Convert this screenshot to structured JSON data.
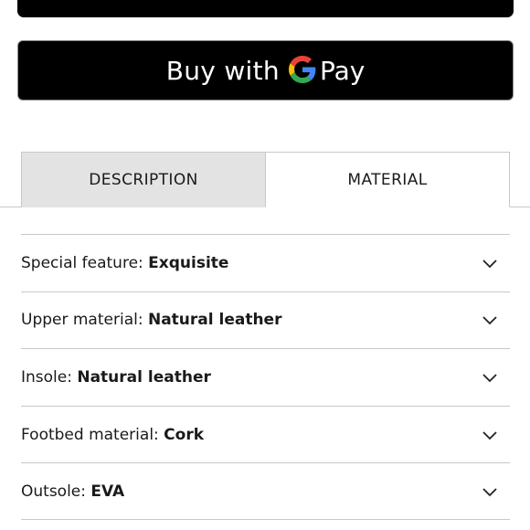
{
  "payment": {
    "gpay_prefix": "Buy with",
    "gpay_suffix": "Pay"
  },
  "tabs": [
    {
      "label": "DESCRIPTION",
      "active": false
    },
    {
      "label": "MATERIAL",
      "active": true
    }
  ],
  "details": [
    {
      "key": "Special feature: ",
      "value": "Exquisite"
    },
    {
      "key": "Upper material: ",
      "value": "Natural leather"
    },
    {
      "key": "Insole: ",
      "value": "Natural leather"
    },
    {
      "key": "Footbed material: ",
      "value": "Cork"
    },
    {
      "key": "Outsole: ",
      "value": "EVA"
    }
  ],
  "icons": {
    "expand": "chevron-down-icon",
    "gpay": "google-g-icon"
  }
}
